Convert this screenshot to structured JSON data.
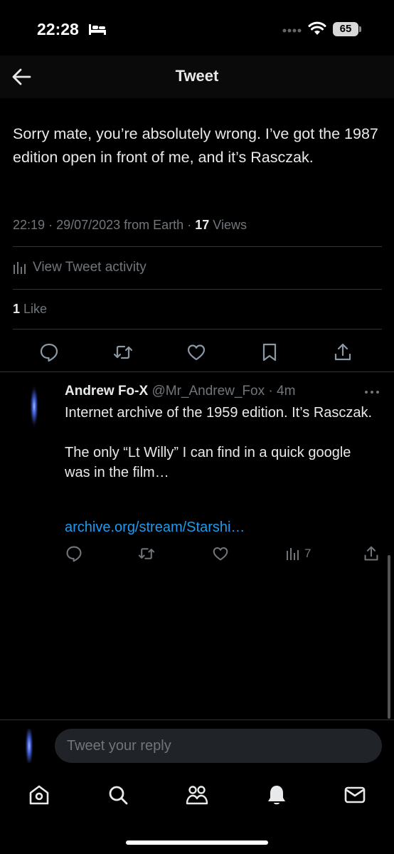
{
  "status_bar": {
    "time": "22:28",
    "battery": "65"
  },
  "header": {
    "title": "Tweet",
    "back_icon": "arrow-left-icon"
  },
  "tweet": {
    "text": "Sorry mate, you’re absolutely wrong. I’ve got the 1987 edition open in front of me, and it’s Rasczak.",
    "time": "22:19",
    "date": "29/07/2023",
    "source": "from Earth",
    "views_count": "17",
    "views_label": "Views",
    "activity_label": "View Tweet activity",
    "likes_count": "1",
    "likes_label": "Like"
  },
  "actions": [
    "reply-icon",
    "retweet-icon",
    "like-icon",
    "bookmark-icon",
    "share-icon"
  ],
  "reply": {
    "name": "Andrew Fo-X",
    "handle": "@Mr_Andrew_Fox",
    "age": "4m",
    "text_line1": "Internet archive of the 1959 edition. It’s Rasczak.",
    "text_line2": "The only “Lt Willy” I can find in a quick google was in the film…",
    "link": "archive.org/stream/Starshi…",
    "views": "7"
  },
  "compose": {
    "placeholder": "Tweet your reply"
  },
  "tabs": [
    "home-icon",
    "search-icon",
    "communities-icon",
    "notifications-icon",
    "messages-icon"
  ],
  "colors": {
    "background": "#000000",
    "text": "#e7e9ea",
    "muted": "#71767b",
    "link": "#1d9bf0",
    "divider": "#2f3336"
  }
}
